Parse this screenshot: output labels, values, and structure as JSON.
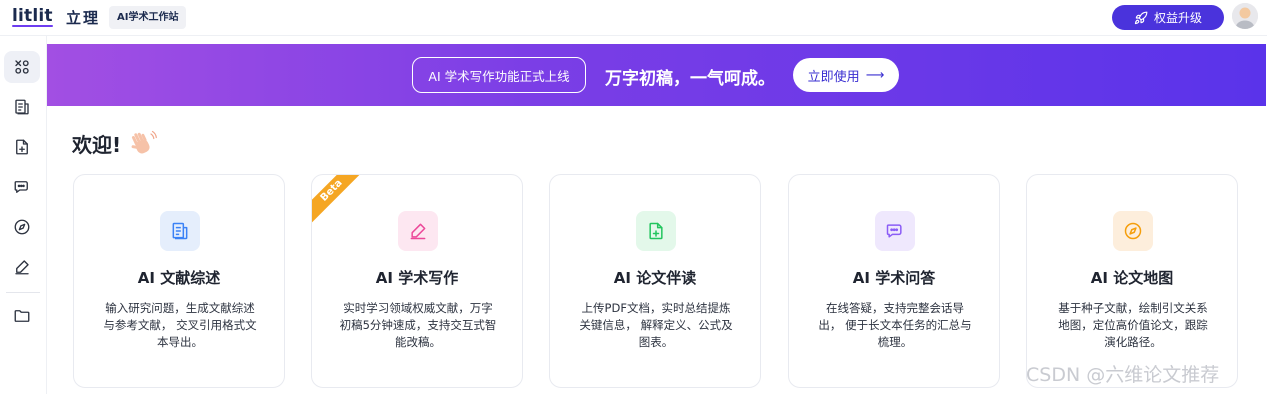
{
  "header": {
    "logo": "litlit",
    "logo_cn": "立理",
    "station": "AI学术工作站",
    "upgrade_label": "权益升级"
  },
  "sidebar": {
    "items": [
      {
        "icon": "apps-icon",
        "active": true
      },
      {
        "icon": "document-icon"
      },
      {
        "icon": "file-add-icon"
      },
      {
        "icon": "chat-icon"
      },
      {
        "icon": "compass-icon"
      },
      {
        "icon": "pen-icon"
      },
      {
        "icon": "folder-icon"
      }
    ]
  },
  "banner": {
    "pill": "AI 学术写作功能正式上线",
    "slogan": "万字初稿，一气呵成。",
    "cta": "立即使用",
    "cta_arrow": "⟶"
  },
  "welcome": {
    "text": "欢迎!"
  },
  "cards": [
    {
      "title": "AI 文献综述",
      "desc": "输入研究问题，生成文献综述与参考文献， 交叉引用格式文本导出。",
      "icon": "document-icon",
      "color": "#3b82f6",
      "bg": "#e5eefc"
    },
    {
      "title": "AI 学术写作",
      "desc": "实时学习领域权威文献，万字初稿5分钟速成，支持交互式智能改稿。",
      "icon": "pen-icon",
      "color": "#ec4899",
      "bg": "#fde7f1",
      "badge": "Beta"
    },
    {
      "title": "AI 论文伴读",
      "desc": "上传PDF文档，实时总结提炼关键信息， 解释定义、公式及图表。",
      "icon": "file-add-icon",
      "color": "#22c55e",
      "bg": "#e3f8ea"
    },
    {
      "title": "AI 学术问答",
      "desc": "在线答疑，支持完整会话导出， 便于长文本任务的汇总与梳理。",
      "icon": "chat-icon",
      "color": "#8b5cf6",
      "bg": "#efe8fd"
    },
    {
      "title": "AI 论文地图",
      "desc": "基于种子文献，绘制引文关系地图，定位高价值论文，跟踪演化路径。",
      "icon": "compass-icon",
      "color": "#f59e0b",
      "bg": "#fdeedc"
    }
  ],
  "watermark": "CSDN @六维论文推荐"
}
